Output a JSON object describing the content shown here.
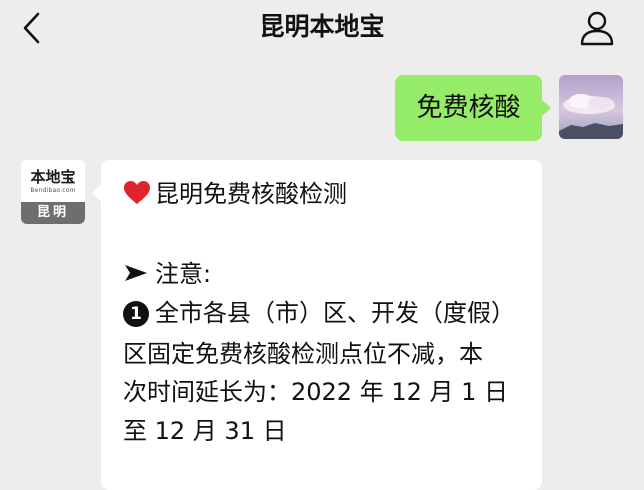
{
  "header": {
    "title": "昆明本地宝",
    "back_icon": "chevron-left-icon",
    "profile_icon": "user-icon"
  },
  "outgoing": {
    "text": "免费核酸",
    "bubble_color": "#95ec69"
  },
  "brand_avatar": {
    "name": "本地宝",
    "domain": "Bendibao.com",
    "city": "昆明"
  },
  "incoming": {
    "heading": "昆明免费核酸检测",
    "heading_icon": "heart-icon",
    "note_label": "注意:",
    "note_icon": "arrow-right-icon",
    "item_number": "1",
    "item_lines": [
      "全市各县（市）区、开发（度假）",
      "区固定免费核酸检测点位不减，本",
      "次时间延长为：2022 年 12 月 1 日",
      "至 12 月 31 日"
    ]
  },
  "colors": {
    "background": "#ededed",
    "incoming_bubble": "#ffffff",
    "heart": "#e0242b"
  }
}
